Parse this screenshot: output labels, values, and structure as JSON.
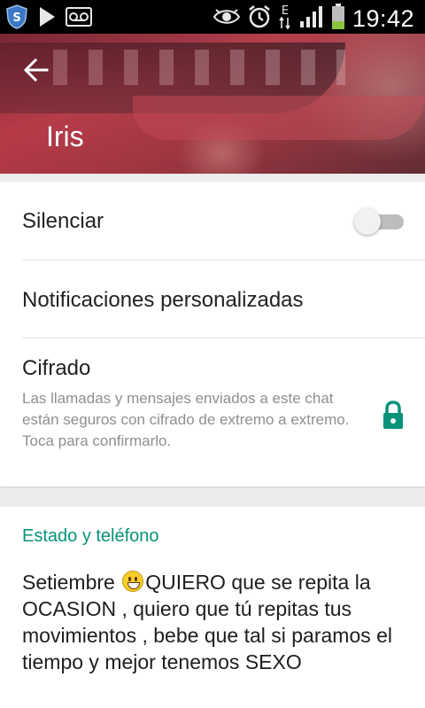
{
  "status_bar": {
    "time": "19:42",
    "network_label": "E",
    "icons": [
      "shield-icon",
      "play-icon",
      "voicemail-icon",
      "eye-icon",
      "alarm-icon",
      "data-arrows-icon",
      "signal-icon",
      "battery-icon"
    ]
  },
  "header": {
    "contact_name": "Iris",
    "back_icon": "arrow-left-icon"
  },
  "settings": {
    "mute_label": "Silenciar",
    "mute_enabled": false,
    "custom_notifications_label": "Notificaciones personalizadas",
    "encryption_label": "Cifrado",
    "encryption_description": "Las llamadas y mensajes enviados a este chat están seguros con cifrado de extremo a extremo. Toca para confirmarlo.",
    "encryption_icon": "lock-icon"
  },
  "status_section": {
    "title": "Estado y teléfono",
    "status_before_emoji": "Setiembre ",
    "emoji_icon": "grinning-face-emoji",
    "status_after_emoji": "QUIERO que se repita la OCASION , quiero que tú repitas tus movimientos , bebe que tal si paramos el tiempo y mejor tenemos SEXO"
  },
  "colors": {
    "accent": "#07927a",
    "header_tint": "#b8444f",
    "status_bar": "#000000"
  }
}
